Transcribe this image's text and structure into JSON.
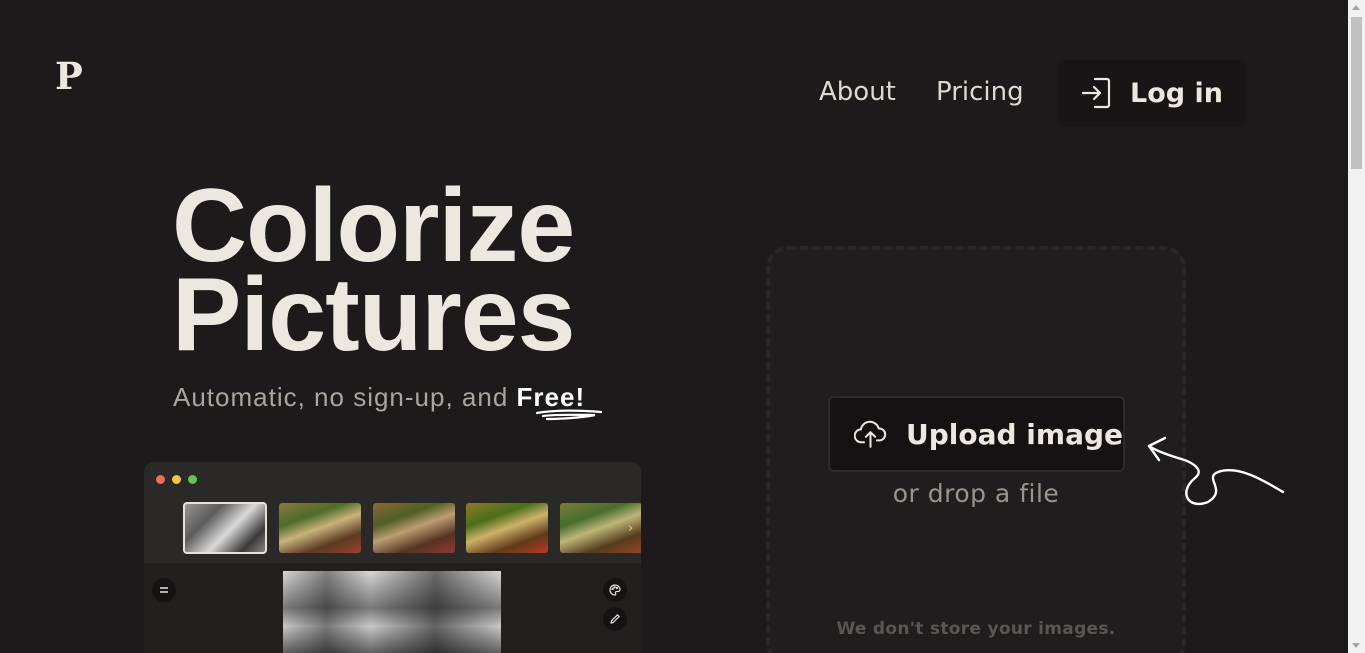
{
  "logo": {
    "letter": "P"
  },
  "nav": {
    "about": "About",
    "pricing": "Pricing",
    "login": "Log in"
  },
  "hero": {
    "title_line1": "Colorize",
    "title_line2": "Pictures",
    "subtitle_prefix": "Automatic, no sign-up, and ",
    "subtitle_free": "Free!"
  },
  "upload": {
    "button_label": "Upload image",
    "drop_text": "or drop a file",
    "privacy_note": "We don't store your images."
  },
  "colors": {
    "background": "#1c1a1a",
    "text": "#ece8df",
    "muted": "#aaa59e"
  },
  "icons": {
    "login": "login-icon",
    "upload": "cloud-upload-icon",
    "menu": "menu-icon",
    "palette": "palette-icon",
    "pen": "pen-icon",
    "next": "chevron-right-icon"
  }
}
